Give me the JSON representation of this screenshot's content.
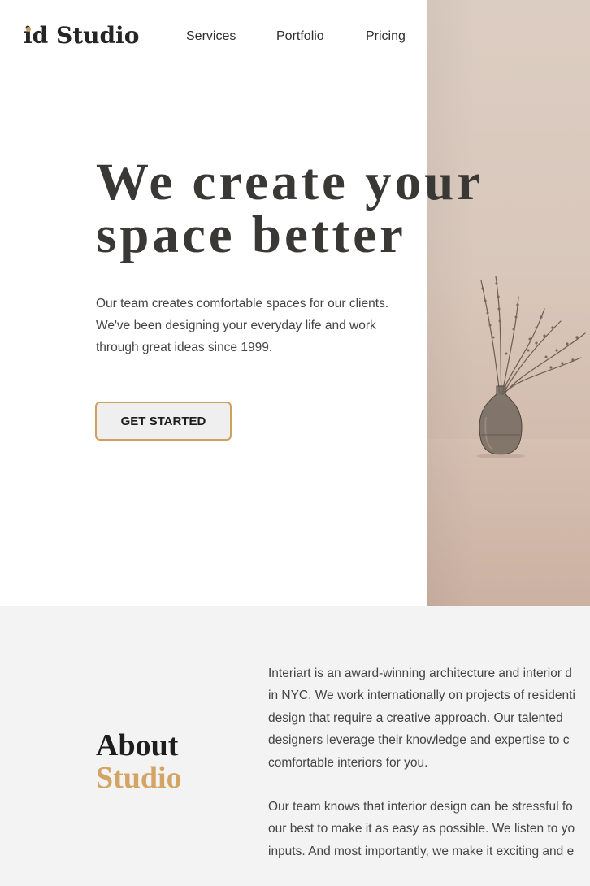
{
  "header": {
    "logo_prefix": "id",
    "logo_word": "Studio",
    "nav": [
      "Services",
      "Portfolio",
      "Pricing"
    ]
  },
  "hero": {
    "title_line1": "We create your",
    "title_line2": "space better",
    "description": "Our team creates comfortable spaces for our clients. We've been designing your everyday life and work through great ideas since 1999.",
    "cta_label": "GET STARTED"
  },
  "about": {
    "title_line1": "About",
    "title_line2": "Studio",
    "paragraph1_lines": [
      "Interiart is an award-winning architecture and interior d",
      "in NYC. We work internationally on projects of residenti",
      "design that require a creative approach. Our talented",
      "designers leverage their knowledge and expertise to c",
      "comfortable interiors for you."
    ],
    "paragraph2_lines": [
      "Our team knows that interior design can be stressful fo",
      "our best to make it as easy as possible. We listen to yo",
      "inputs. And most importantly, we make it exciting and e"
    ]
  },
  "colors": {
    "accent": "#d0a05f",
    "heading": "#3a3835",
    "about_bg": "#f3f3f3",
    "photo_bg": "#d9c7bb"
  },
  "icons": {
    "photo": "vase-with-dried-pampas-grass"
  }
}
